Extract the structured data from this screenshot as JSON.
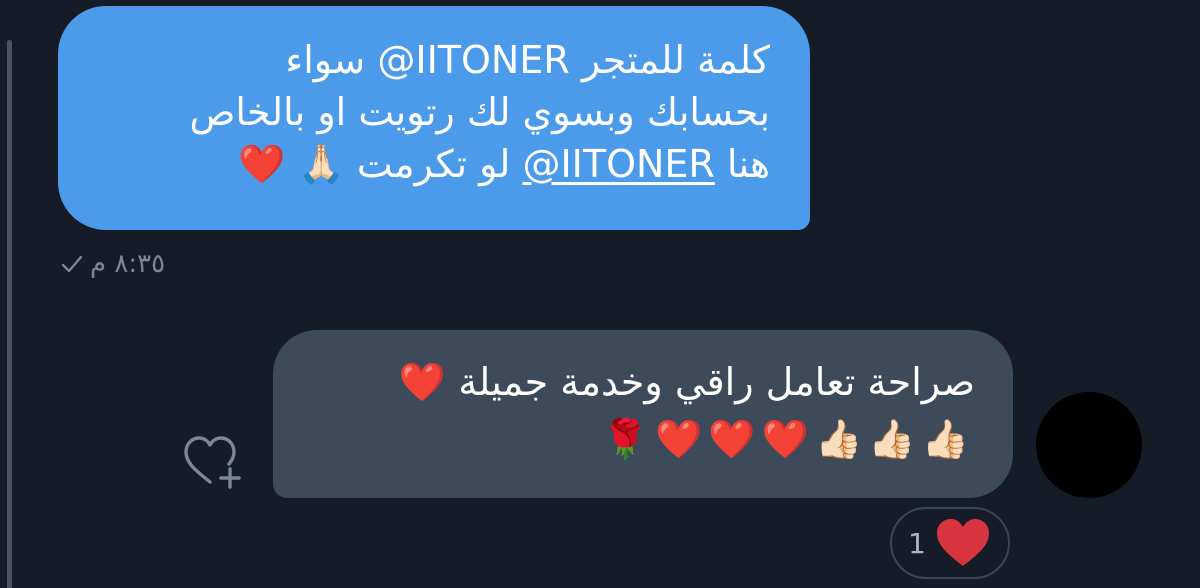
{
  "conversation": {
    "sent_message": {
      "lines": [
        "كلمة للمتجر  IITONER@ سواء",
        "بحسابك وبسوي لك رتويت او بالخاص"
      ],
      "line3_prefix": "هنا ",
      "line3_mention": "IITONER@",
      "line3_suffix": " لو تكرمت 🙏🏻 ❤️",
      "timestamp": "٨:٣٥ م"
    },
    "received_message": {
      "text_line": "صراحة تعامل راقي وخدمة جميلة ❤️",
      "emoji_line": "👍🏻👍🏻👍🏻❤️❤️❤️🌹"
    },
    "reaction": {
      "count": "1",
      "emoji": "heart-icon"
    }
  },
  "colors": {
    "background": "#151c27",
    "sent_bubble": "#4b9bea",
    "received_bubble": "#3c4a5a",
    "meta_text": "#7d8693",
    "reaction_heart": "#d7343e"
  }
}
